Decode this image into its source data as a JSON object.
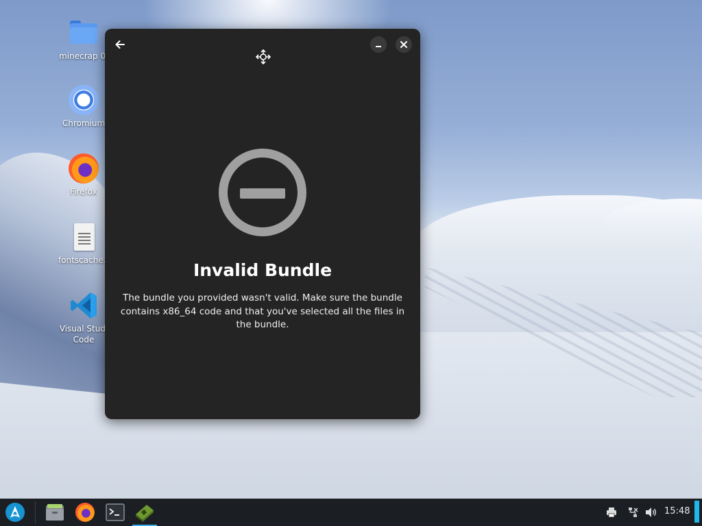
{
  "desktop": {
    "icons": [
      {
        "label": "minecrap 0.",
        "icon": "folder-icon"
      },
      {
        "label": "Chromium",
        "icon": "chromium-icon"
      },
      {
        "label": "Firefox",
        "icon": "firefox-icon"
      },
      {
        "label": "fontscache.t",
        "icon": "text-file-icon"
      },
      {
        "label": "Visual Studi\nCode",
        "icon": "vscode-icon"
      }
    ]
  },
  "dialog": {
    "icon": "invalid-circle-icon",
    "title": "Invalid Bundle",
    "description": "The bundle you provided wasn't valid. Make sure the bundle contains x86_64 code and that you've selected all the files in the bundle.",
    "colors": {
      "background": "#242424",
      "icon": "#a0a0a0"
    }
  },
  "taskbar": {
    "launcher_icon": "arch-linux-icon",
    "apps": [
      {
        "name": "file-manager-icon"
      },
      {
        "name": "firefox-icon"
      },
      {
        "name": "terminal-icon"
      },
      {
        "name": "minecraft-installer-icon",
        "active": true
      }
    ],
    "tray": [
      "printer-icon",
      "network-disconnected-icon",
      "volume-icon"
    ],
    "clock": "15:48",
    "accent": "#3daee9"
  }
}
